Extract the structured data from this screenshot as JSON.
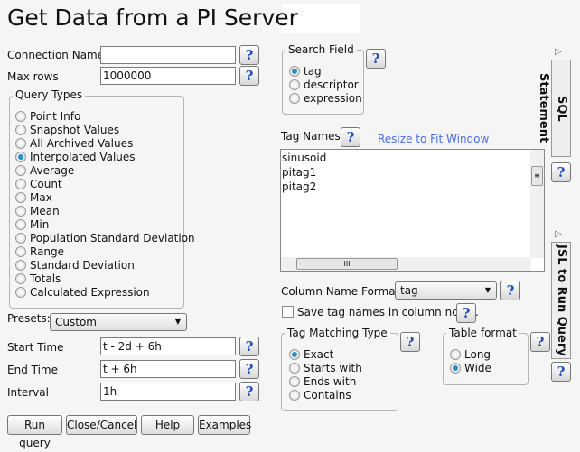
{
  "title": "Get Data from a PI Server",
  "connection": {
    "label": "Connection Name",
    "value": ""
  },
  "max_rows": {
    "label": "Max rows",
    "value": "1000000"
  },
  "query_types": {
    "legend": "Query Types",
    "selected": "Interpolated Values",
    "items": [
      "Point Info",
      "Snapshot Values",
      "All Archived Values",
      "Interpolated Values",
      "Average",
      "Count",
      "Max",
      "Mean",
      "Min",
      "Population Standard Deviation",
      "Range",
      "Standard Deviation",
      "Totals",
      "Calculated Expression"
    ]
  },
  "presets": {
    "label": "Presets:",
    "value": "Custom"
  },
  "start_time": {
    "label": "Start Time",
    "value": "t - 2d + 6h"
  },
  "end_time": {
    "label": "End Time",
    "value": "t + 6h"
  },
  "interval": {
    "label": "Interval",
    "value": "1h"
  },
  "buttons": {
    "run": "Run query",
    "close": "Close/Cancel",
    "help": "Help",
    "examples": "Examples"
  },
  "search_field": {
    "legend": "Search Field",
    "selected": "tag",
    "items": [
      "tag",
      "descriptor",
      "expression"
    ]
  },
  "tag_names": {
    "label": "Tag Names",
    "resize_link": "Resize to Fit Window",
    "items": [
      "sinusoid",
      "pitag1",
      "pitag2"
    ]
  },
  "column_name_format": {
    "label": "Column Name Format:",
    "value": "tag"
  },
  "save_tag_names": {
    "label": "Save tag names in column notes.",
    "checked": false
  },
  "tag_matching": {
    "legend": "Tag Matching Type",
    "selected": "Exact",
    "items": [
      "Exact",
      "Starts with",
      "Ends with",
      "Contains"
    ]
  },
  "table_format": {
    "legend": "Table format",
    "selected": "Wide",
    "items": [
      "Long",
      "Wide"
    ]
  },
  "side_tabs": {
    "sql": "SQL Statement",
    "jsl": "JSL to Run Query"
  },
  "help_glyph": "?",
  "colors": {
    "link": "#4a6cf0",
    "radio_selected": "#2a8fc4",
    "help_icon": "#1f4fc0"
  }
}
